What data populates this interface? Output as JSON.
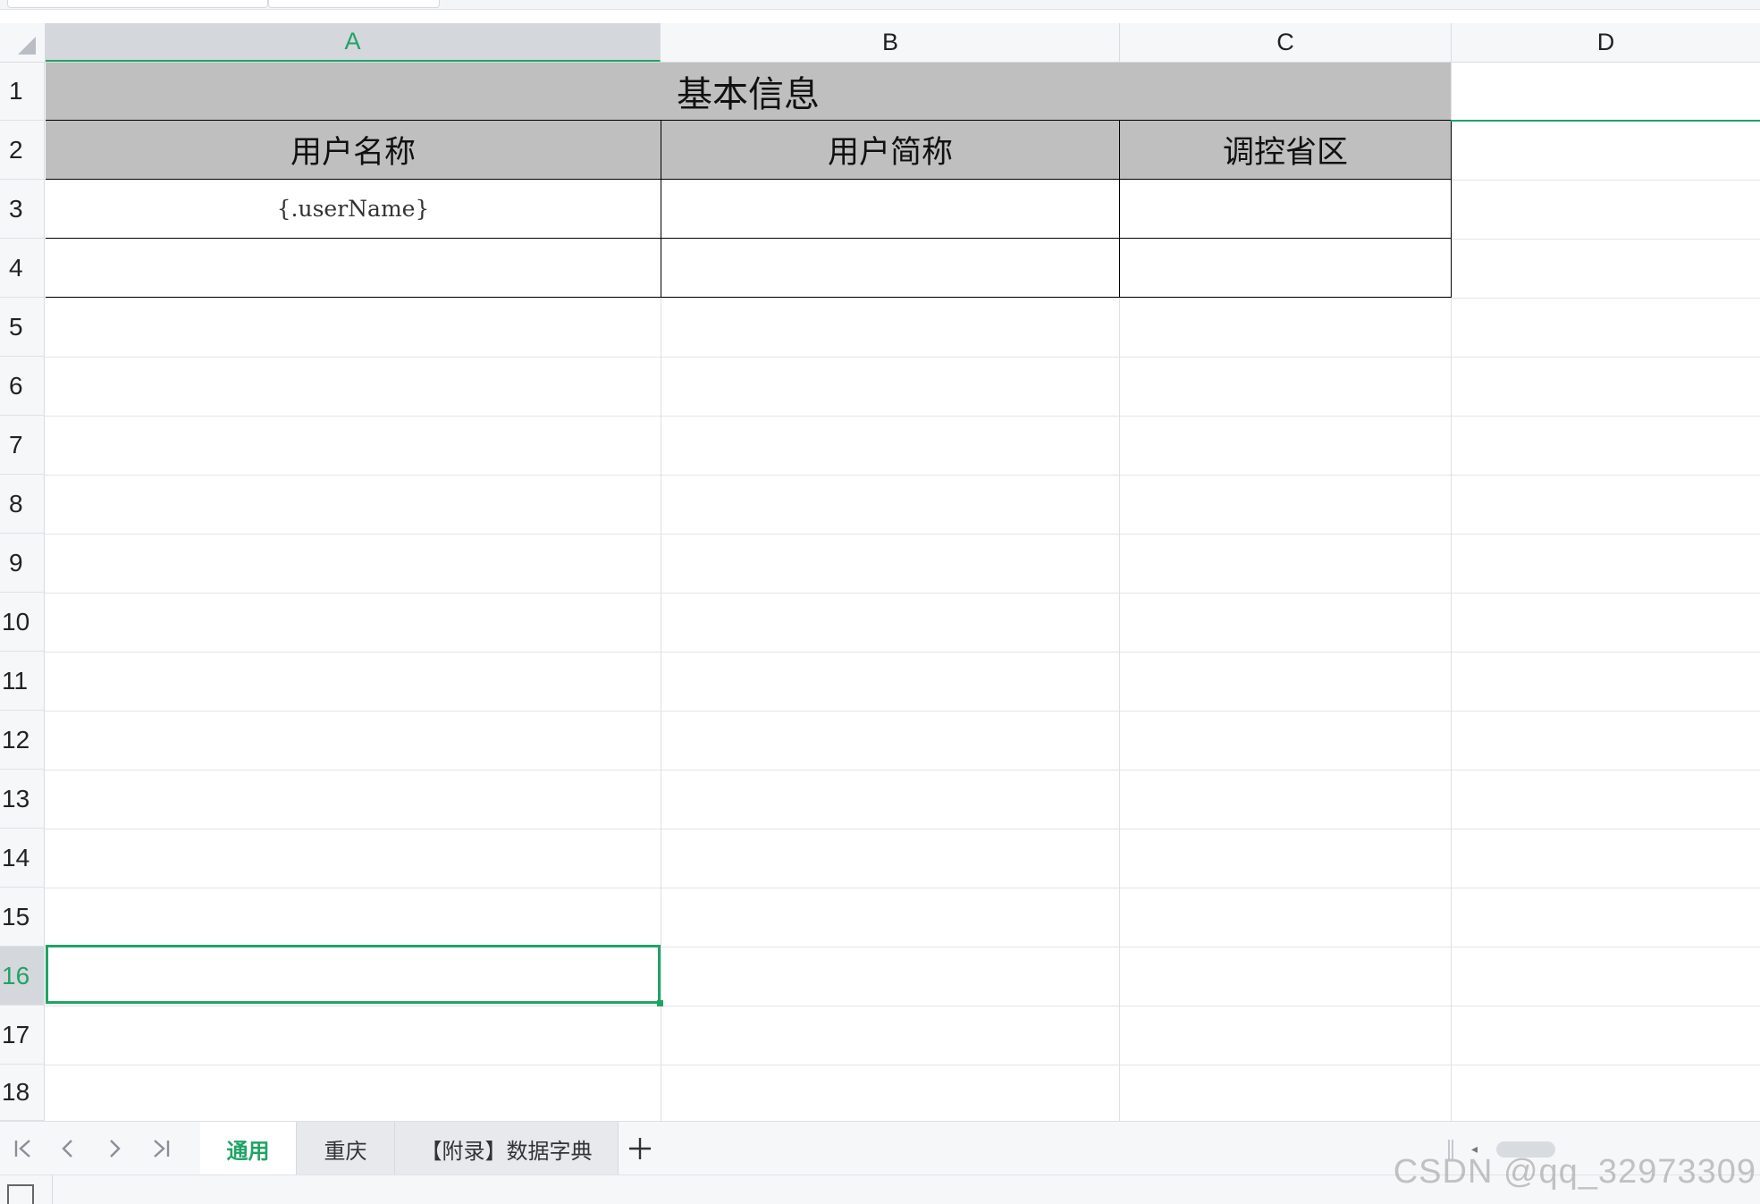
{
  "columns": [
    "A",
    "B",
    "C",
    "D"
  ],
  "active_column": "A",
  "rows": [
    "1",
    "2",
    "3",
    "4",
    "5",
    "6",
    "7",
    "8",
    "9",
    "10",
    "11",
    "12",
    "13",
    "14",
    "15",
    "16",
    "17",
    "18"
  ],
  "active_row": "16",
  "sheet": {
    "title": "基本信息",
    "headers": [
      "用户名称",
      "用户简称",
      "调控省区"
    ],
    "cells": {
      "A3": "{.userName}"
    }
  },
  "tabs": [
    {
      "label": "通用",
      "active": true
    },
    {
      "label": "重庆",
      "active": false
    },
    {
      "label": "【附录】数据字典",
      "active": false
    }
  ],
  "add_sheet_label": "+",
  "watermark": "CSDN @qq_32973309",
  "colors": {
    "accent": "#21a366",
    "header_fill": "#bfbfbf"
  }
}
